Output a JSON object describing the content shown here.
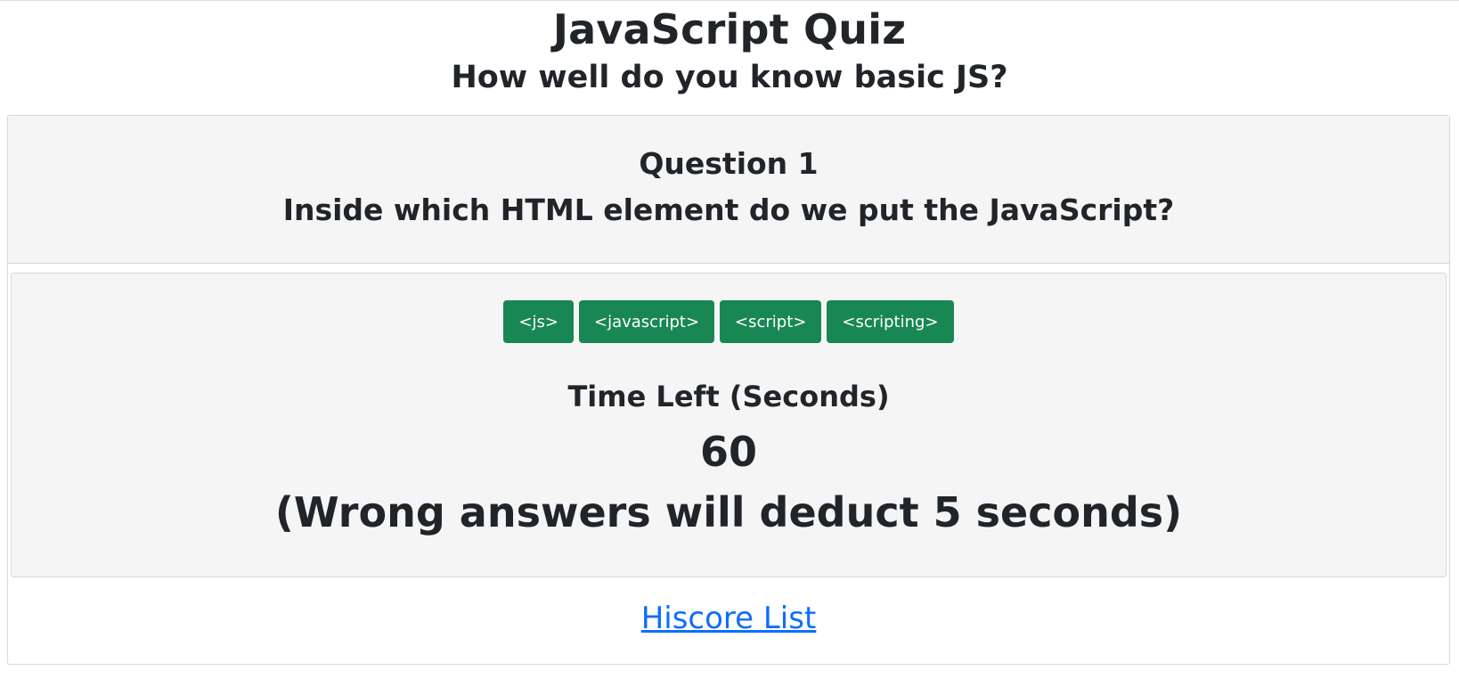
{
  "header": {
    "title": "JavaScript Quiz",
    "subtitle": "How well do you know basic JS?"
  },
  "question": {
    "number_label": "Question 1",
    "text": "Inside which HTML element do we put the JavaScript?"
  },
  "choices": [
    {
      "label": "<js>"
    },
    {
      "label": "<javascript>"
    },
    {
      "label": "<script>"
    },
    {
      "label": "<scripting>"
    }
  ],
  "timer": {
    "label": "Time Left (Seconds)",
    "value": "60",
    "penalty_note": "(Wrong answers will deduct 5 seconds)"
  },
  "footer": {
    "hiscore_link": "Hiscore List"
  },
  "colors": {
    "button_green": "#198754",
    "link_blue": "#0d6efd",
    "panel_gray": "#f5f5f5"
  }
}
